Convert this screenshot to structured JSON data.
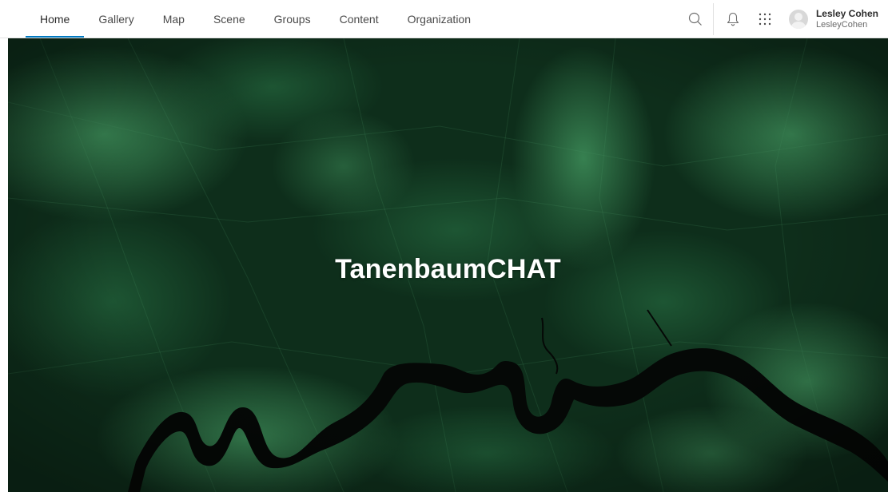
{
  "nav": {
    "items": [
      {
        "label": "Home",
        "active": true
      },
      {
        "label": "Gallery",
        "active": false
      },
      {
        "label": "Map",
        "active": false
      },
      {
        "label": "Scene",
        "active": false
      },
      {
        "label": "Groups",
        "active": false
      },
      {
        "label": "Content",
        "active": false
      },
      {
        "label": "Organization",
        "active": false
      }
    ]
  },
  "tools": {
    "search_icon": "search-icon",
    "notifications_icon": "bell-icon",
    "apps_icon": "app-launcher-icon"
  },
  "user": {
    "name": "Lesley Cohen",
    "username": "LesleyCohen"
  },
  "hero": {
    "title": "TanenbaumCHAT"
  },
  "colors": {
    "accent": "#0079c1",
    "hero_dark": "#0c2a19",
    "hero_mid": "#1f5a36",
    "hero_light": "#3e8f5a",
    "river": "#050806"
  }
}
